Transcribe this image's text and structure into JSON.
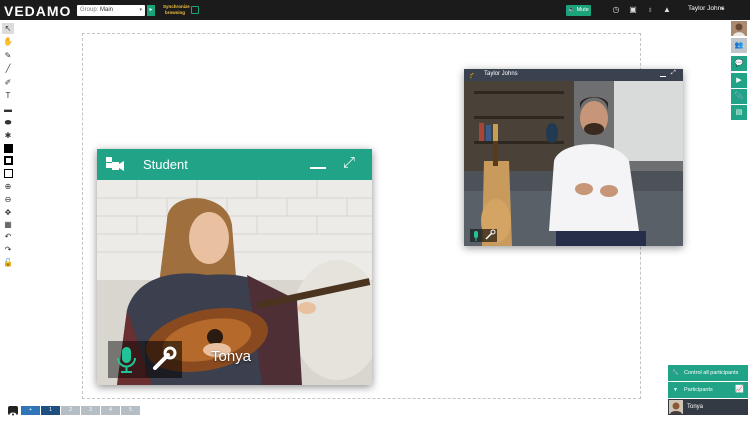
{
  "app": {
    "logo": "VEDAMO"
  },
  "topbar": {
    "group_label": "Group:",
    "group_value": "Main",
    "group_caret": "▾",
    "group_button": "▸",
    "sync_line1": "Synchronize",
    "sync_line2": "browsing",
    "mute_label": "Mute",
    "user_name": "Taylor Johns",
    "user_caret": "▾"
  },
  "student_window": {
    "title": "Student",
    "participant_name": "Tonya"
  },
  "teacher_window": {
    "title": "Taylor Johns"
  },
  "bottom_panel": {
    "control_all": "Control all participants",
    "participants": "Participants",
    "participant_name": "Tonya"
  },
  "pages": [
    "+",
    "1",
    "2",
    "3",
    "4",
    "5"
  ],
  "colors": {
    "accent": "#21a387",
    "topbar": "#1b1b1b",
    "active_page": "#3075b8"
  }
}
